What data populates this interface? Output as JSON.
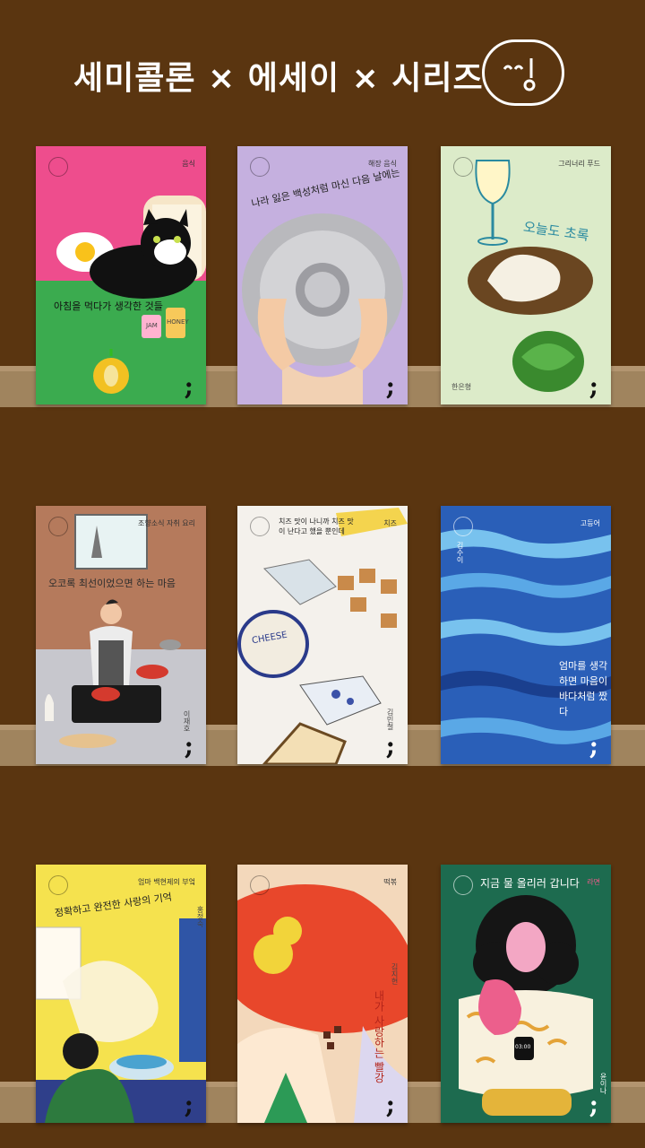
{
  "header": {
    "title": "세미콜론 × 에세이 × 시리즈",
    "logo_icon": "face-logo-icon"
  },
  "colors": {
    "background": "#5a3510",
    "shelf": "#a0845e"
  },
  "books": [
    {
      "category": "음식",
      "title": "아침을 먹다가 생각한 것들",
      "author": "",
      "cover_color": "#ee4d8d",
      "icons": [
        "cat-icon",
        "bread-icon",
        "jam-jar-icon",
        "apple-icon"
      ],
      "jar_labels": [
        "JAM",
        "HONEY"
      ]
    },
    {
      "category": "해장 음식",
      "title": "나라 잃은 백성처럼 마신 다음 날에는",
      "author": "",
      "cover_color": "#c5b0df",
      "icons": [
        "bowl-icon",
        "hands-icon"
      ]
    },
    {
      "category": "그리너리 푸드",
      "title": "오늘도 초록",
      "author": "한은형",
      "cover_color": "#dcebc9",
      "icons": [
        "wine-glass-icon",
        "cauliflower-icon",
        "artichoke-icon"
      ]
    },
    {
      "category": "조향소식 자취 요리",
      "title": "오코록 최선이었으면 하는 마음",
      "author": "이재호",
      "cover_color": "#b57a5c",
      "icons": [
        "cook-icon",
        "cat-icon",
        "stove-icon",
        "baguette-icon"
      ]
    },
    {
      "category": "치즈",
      "title": "치즈 맛이 나니까 치즈 맛이 난다고 했을 뿐인데",
      "author": "김민철",
      "cover_color": "#f4f1ec",
      "icons": [
        "cheese-wheel-icon",
        "cheese-cubes-icon",
        "blue-cheese-icon"
      ],
      "cheese_label": "CHEESE"
    },
    {
      "category": "고등어",
      "title": "엄마를 생각하면 마음이 바다처럼 짰다",
      "author": "김수이",
      "cover_color": "#2d6cc8",
      "icons": [
        "sea-waves-icon"
      ]
    },
    {
      "category": "엄마 백현제의 부엌",
      "title": "정확하고 완전한 사랑의 기억",
      "author": "홍정숙",
      "cover_color": "#f5e24e",
      "icons": [
        "pot-icon",
        "person-icon",
        "window-icon"
      ]
    },
    {
      "category": "떡볶",
      "title": "내가 사랑하는 빨강",
      "author": "김지현",
      "cover_color": "#f3d8bb",
      "icons": [
        "red-shapes-icon",
        "yellow-circle-icon"
      ]
    },
    {
      "category": "라면",
      "title": "지금 물 올리러 갑니다",
      "author": "윤이나",
      "cover_color": "#1d6b4f",
      "icons": [
        "curly-hair-woman-icon",
        "noodles-icon",
        "watch-icon"
      ],
      "watch_text": "03:00"
    }
  ]
}
